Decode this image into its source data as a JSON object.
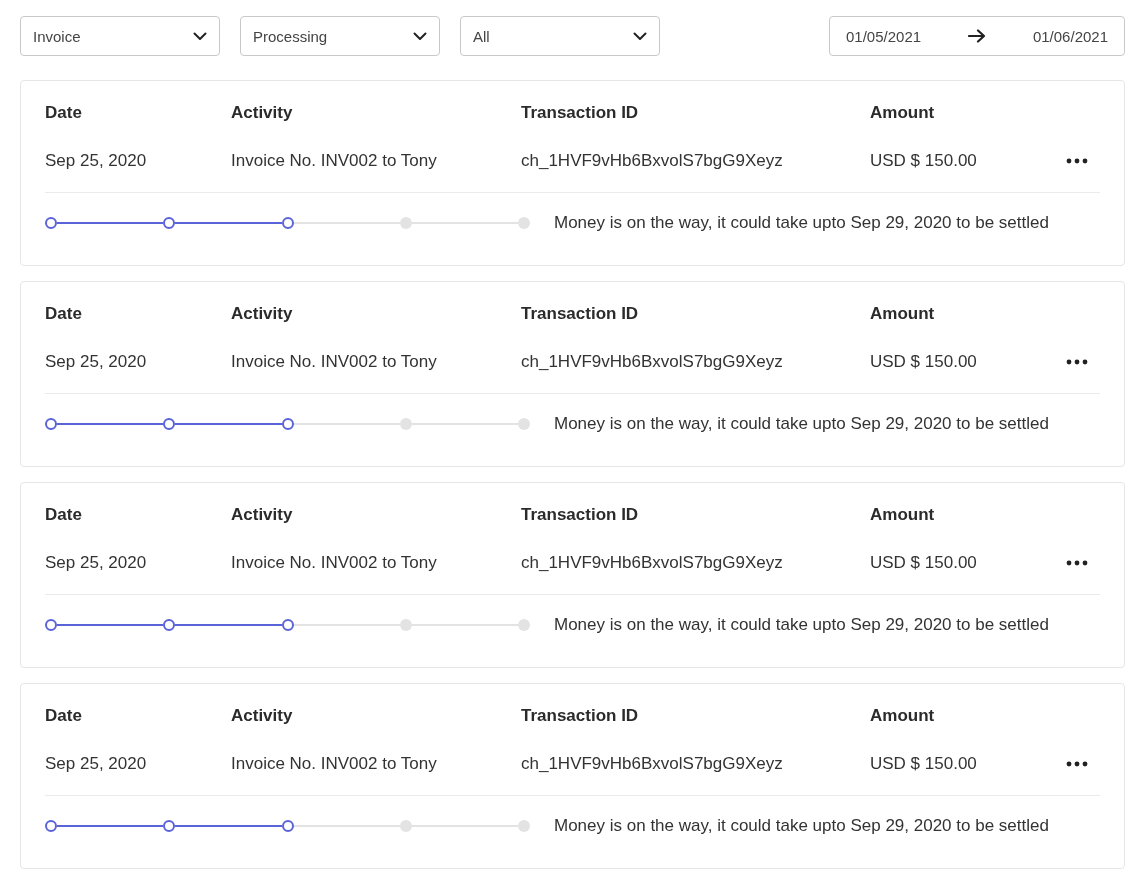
{
  "filters": [
    {
      "value": "Invoice"
    },
    {
      "value": "Processing"
    },
    {
      "value": "All"
    }
  ],
  "date_range": {
    "from": "01/05/2021",
    "to": "01/06/2021"
  },
  "transactions": [
    {
      "columns": [
        "Date",
        "Activity",
        "Transaction ID",
        "Amount"
      ],
      "date": "Sep 25, 2020",
      "activity": "Invoice No. INV002 to Tony",
      "transaction_id": "ch_1HVF9vHb6BxvolS7bgG9Xeyz",
      "amount": "USD $ 150.00",
      "steps": [
        {
          "done": true
        },
        {
          "done": true
        },
        {
          "done": true
        },
        {
          "done": false
        },
        {
          "done": false
        }
      ],
      "status": "Money is on the way, it could take upto Sep 29, 2020 to be settled"
    },
    {
      "columns": [
        "Date",
        "Activity",
        "Transaction ID",
        "Amount"
      ],
      "date": "Sep 25, 2020",
      "activity": "Invoice No. INV002 to Tony",
      "transaction_id": "ch_1HVF9vHb6BxvolS7bgG9Xeyz",
      "amount": "USD $ 150.00",
      "steps": [
        {
          "done": true
        },
        {
          "done": true
        },
        {
          "done": true
        },
        {
          "done": false
        },
        {
          "done": false
        }
      ],
      "status": "Money is on the way, it could take upto Sep 29, 2020 to be settled"
    },
    {
      "columns": [
        "Date",
        "Activity",
        "Transaction ID",
        "Amount"
      ],
      "date": "Sep 25, 2020",
      "activity": "Invoice No. INV002 to Tony",
      "transaction_id": "ch_1HVF9vHb6BxvolS7bgG9Xeyz",
      "amount": "USD $ 150.00",
      "steps": [
        {
          "done": true
        },
        {
          "done": true
        },
        {
          "done": true
        },
        {
          "done": false
        },
        {
          "done": false
        }
      ],
      "status": "Money is on the way, it could take upto Sep 29, 2020 to be settled"
    },
    {
      "columns": [
        "Date",
        "Activity",
        "Transaction ID",
        "Amount"
      ],
      "date": "Sep 25, 2020",
      "activity": "Invoice No. INV002 to Tony",
      "transaction_id": "ch_1HVF9vHb6BxvolS7bgG9Xeyz",
      "amount": "USD $ 150.00",
      "steps": [
        {
          "done": true
        },
        {
          "done": true
        },
        {
          "done": true
        },
        {
          "done": false
        },
        {
          "done": false
        }
      ],
      "status": "Money is on the way, it could take upto Sep 29, 2020 to be settled"
    }
  ]
}
